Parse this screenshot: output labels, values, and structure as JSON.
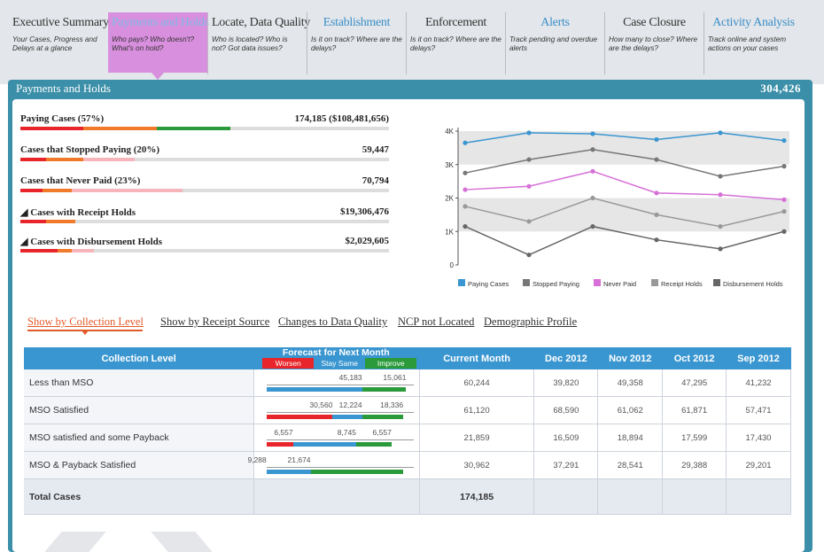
{
  "nav": [
    {
      "title": "Executive Summary",
      "desc": "Your Cases, Progress and Delays at a glance"
    },
    {
      "title": "Payments and Holds",
      "desc": "Who pays? Who doesn't? What's on hold?"
    },
    {
      "title": "Locate, Data Quality",
      "desc": "Who is located? Who is not? Got data issues?"
    },
    {
      "title": "Establishment",
      "desc": "Is it on track? Where are the delays?"
    },
    {
      "title": "Enforcement",
      "desc": "Is it on track? Where are the delays?"
    },
    {
      "title": "Alerts",
      "desc": "Track pending and overdue alerts"
    },
    {
      "title": "Case Closure",
      "desc": "How many to close? Where are the delays?"
    },
    {
      "title": "Activity Analysis",
      "desc": "Track online and system actions on your cases"
    }
  ],
  "panel": {
    "title": "Payments and Holds",
    "total": "304,426"
  },
  "metrics": [
    {
      "label": "Paying Cases (57%)",
      "value": "174,185 ($108,481,656)",
      "bar": [
        {
          "w": 0.17,
          "c": "#e8252a"
        },
        {
          "w": 0.2,
          "c": "#f07a2a"
        },
        {
          "w": 0.2,
          "c": "#2a9a3a"
        },
        {
          "w": 0.43,
          "c": "#dddddd"
        }
      ]
    },
    {
      "label": "Cases that Stopped Paying (20%)",
      "value": "59,447",
      "bar": [
        {
          "w": 0.07,
          "c": "#e8252a"
        },
        {
          "w": 0.1,
          "c": "#f07a2a"
        },
        {
          "w": 0.14,
          "c": "#f5b5bb"
        },
        {
          "w": 0.69,
          "c": "#dddddd"
        }
      ]
    },
    {
      "label": "Cases that Never Paid (23%)",
      "value": "70,794",
      "bar": [
        {
          "w": 0.06,
          "c": "#e8252a"
        },
        {
          "w": 0.08,
          "c": "#f07a2a"
        },
        {
          "w": 0.3,
          "c": "#f5b5bb"
        },
        {
          "w": 0.56,
          "c": "#dddddd"
        }
      ]
    },
    {
      "label": "◢ Cases with Receipt Holds",
      "value": "$19,306,476",
      "bar": [
        {
          "w": 0.07,
          "c": "#e8252a"
        },
        {
          "w": 0.08,
          "c": "#f07a2a"
        },
        {
          "w": 0.0,
          "c": "#f5b5bb"
        },
        {
          "w": 0.85,
          "c": "#dddddd"
        }
      ]
    },
    {
      "label": "◢ Cases with Disbursement Holds",
      "value": "$2,029,605",
      "bar": [
        {
          "w": 0.1,
          "c": "#e8252a"
        },
        {
          "w": 0.04,
          "c": "#f07a2a"
        },
        {
          "w": 0.06,
          "c": "#f5b5bb"
        },
        {
          "w": 0.8,
          "c": "#dddddd"
        }
      ]
    }
  ],
  "chart_data": {
    "type": "line",
    "yticks": [
      "0",
      "1K",
      "2K",
      "3K",
      "4K"
    ],
    "ylim": [
      0,
      4000
    ],
    "series": [
      {
        "name": "Paying Cases",
        "color": "#3a96d0",
        "values": [
          3650,
          3950,
          3920,
          3750,
          3950,
          3720
        ]
      },
      {
        "name": "Stopped Paying",
        "color": "#777777",
        "values": [
          2750,
          3150,
          3450,
          3150,
          2650,
          2950
        ]
      },
      {
        "name": "Never Paid",
        "color": "#d670d8",
        "values": [
          2250,
          2350,
          2800,
          2150,
          2100,
          1950
        ]
      },
      {
        "name": "Receipt Holds",
        "color": "#999999",
        "values": [
          1750,
          1300,
          2000,
          1500,
          1150,
          1600
        ]
      },
      {
        "name": "Disbursement Holds",
        "color": "#666666",
        "values": [
          1150,
          300,
          1150,
          750,
          480,
          1000
        ]
      }
    ]
  },
  "subtabs": [
    "Show by Collection Level",
    "Show by Receipt Source",
    "Changes to Data Quality",
    "NCP not Located",
    "Demographic Profile"
  ],
  "table": {
    "headers": {
      "level": "Collection Level",
      "forecast": "Forecast for Next Month",
      "worsen": "Worsen",
      "same": "Stay Same",
      "improve": "Improve",
      "current": "Current Month",
      "m1": "Dec 2012",
      "m2": "Nov 2012",
      "m3": "Oct 2012",
      "m4": "Sep 2012"
    },
    "rows": [
      {
        "name": "Less than MSO",
        "f": [
          "",
          "45,183",
          "15,061"
        ],
        "fb": [
          0,
          0.65,
          0.3
        ],
        "current": "60,244",
        "m1": "39,820",
        "m2": "49,358",
        "m3": "47,295",
        "m4": "41,232"
      },
      {
        "name": "MSO Satisfied",
        "f": [
          "30,560",
          "12,224",
          "18,336"
        ],
        "fb": [
          0.45,
          0.2,
          0.28
        ],
        "current": "61,120",
        "m1": "68,590",
        "m2": "61,062",
        "m3": "61,871",
        "m4": "57,471"
      },
      {
        "name": "MSO satisfied and some Payback",
        "f": [
          "6,557",
          "8,745",
          "6,557"
        ],
        "fb": [
          0.18,
          0.43,
          0.24
        ],
        "current": "21,859",
        "m1": "16,509",
        "m2": "18,894",
        "m3": "17,599",
        "m4": "17,430"
      },
      {
        "name": "MSO & Payback Satisfied",
        "f": [
          "9,288",
          "21,674",
          ""
        ],
        "fb": [
          0,
          0.3,
          0.63
        ],
        "current": "30,962",
        "m1": "37,291",
        "m2": "28,541",
        "m3": "29,388",
        "m4": "29,201"
      }
    ],
    "total": {
      "name": "Total Cases",
      "current": "174,185"
    }
  }
}
